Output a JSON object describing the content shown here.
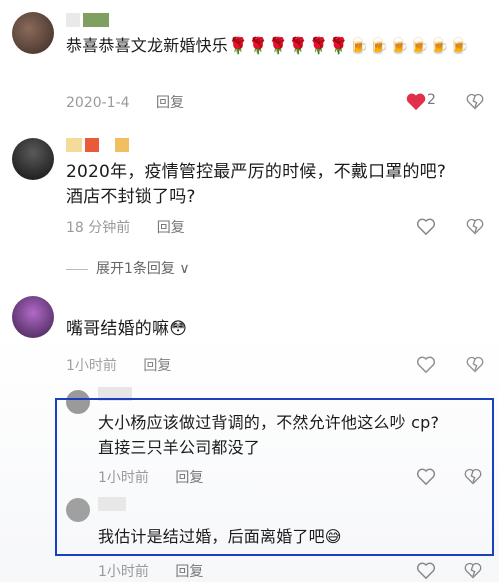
{
  "comments": [
    {
      "text": "恭喜恭喜文龙新婚快乐🌹🌹🌹🌹🌹🌹🍺🍺🍺🍺🍺🍺",
      "time": "2020-1-4",
      "reply": "回复",
      "likes": "2",
      "liked": true
    },
    {
      "text_line1": "2020年，疫情管控最严厉的时候，不戴口罩的吧?",
      "text_line2": "酒店不封锁了吗?",
      "time": "18 分钟前",
      "reply": "回复"
    },
    {
      "text": "嘴哥结婚的嘛😳",
      "time": "1小时前",
      "reply": "回复"
    }
  ],
  "expand_label": "展开1条回复",
  "replies": [
    {
      "text_line1": "大小杨应该做过背调的，不然允许他这么吵 cp?",
      "text_line2": "直接三只羊公司都没了",
      "time": "1小时前",
      "reply": "回复"
    },
    {
      "text": "我估计是结过婚，后面离婚了吧😅",
      "time": "1小时前",
      "reply": "回复"
    }
  ],
  "colors": {
    "highlight_border": "#1a3fbf",
    "like_red": "#e0304a"
  }
}
